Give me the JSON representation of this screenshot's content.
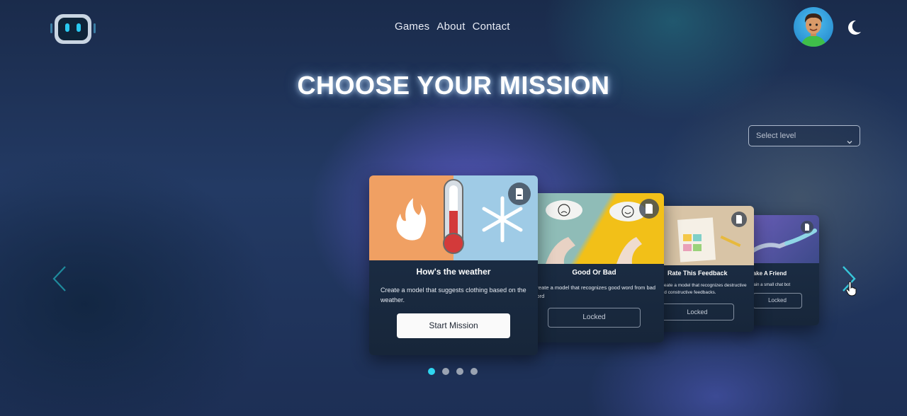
{
  "nav": {
    "games": "Games",
    "about": "About",
    "contact": "Contact"
  },
  "page_title": "CHOOSE YOUR MISSION",
  "level_select": {
    "placeholder": "Select level"
  },
  "missions": [
    {
      "title": "How's the weather",
      "description": "Create a model that suggests clothing based on the weather.",
      "button": "Start Mission",
      "status": "active"
    },
    {
      "title": "Good Or Bad",
      "description": "Create a model that recognizes good word from bad word",
      "button": "Locked",
      "status": "locked"
    },
    {
      "title": "Rate This Feedback",
      "description": "Create a model that recognizes destructive and constructive feedbacks.",
      "button": "Locked",
      "status": "locked"
    },
    {
      "title": "Make A Friend",
      "description": "Train a small chat bot",
      "button": "Locked",
      "status": "locked"
    }
  ],
  "carousel": {
    "page_count": 4,
    "active_page": 1
  },
  "colors": {
    "accent": "#2fd6f0",
    "arrow": "#2ab6c8",
    "card_bg": "#1b2c43"
  },
  "icons": {
    "logo": "robot-logo-icon",
    "theme": "moon-icon",
    "prev": "chevron-left-icon",
    "next": "chevron-right-icon",
    "doc": "pdf-icon"
  }
}
